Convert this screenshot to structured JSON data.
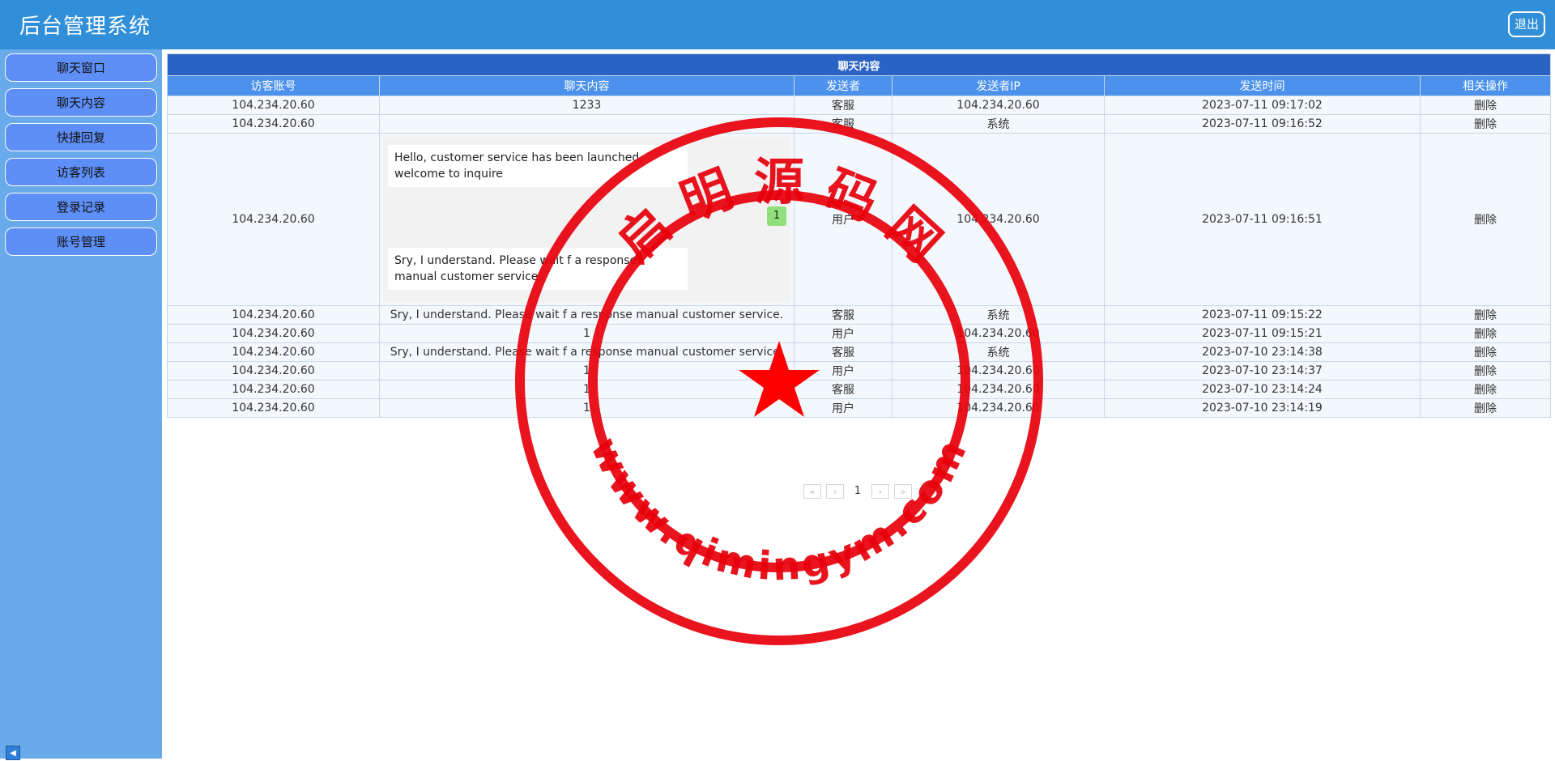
{
  "app": {
    "title": "后台管理系统",
    "logout_label": "退出"
  },
  "sidebar": {
    "items": [
      {
        "label": "聊天窗口"
      },
      {
        "label": "聊天内容"
      },
      {
        "label": "快捷回复"
      },
      {
        "label": "访客列表"
      },
      {
        "label": "登录记录"
      },
      {
        "label": "账号管理"
      }
    ],
    "collapse_icon": "◀"
  },
  "table": {
    "caption": "聊天内容",
    "headers": [
      "访客账号",
      "聊天内容",
      "发送者",
      "发送者IP",
      "发送时间",
      "相关操作"
    ],
    "rows": [
      {
        "account": "104.234.20.60",
        "content": "1233",
        "sender": "客服",
        "ip": "104.234.20.60",
        "time": "2023-07-11 09:17:02",
        "action": "删除"
      },
      {
        "account": "104.234.20.60",
        "content": "",
        "sender": "客服",
        "ip": "系统",
        "time": "2023-07-11 09:16:52",
        "action": "删除"
      },
      {
        "account": "104.234.20.60",
        "content": "",
        "sender": "用户",
        "ip": "104.234.20.60",
        "time": "2023-07-11 09:16:51",
        "action": "删除"
      },
      {
        "account": "104.234.20.60",
        "content": "Sry, I understand. Please wait f a response manual customer service.",
        "sender": "客服",
        "ip": "系统",
        "time": "2023-07-11 09:15:22",
        "action": "删除"
      },
      {
        "account": "104.234.20.60",
        "content": "1",
        "sender": "用户",
        "ip": "104.234.20.60",
        "time": "2023-07-11 09:15:21",
        "action": "删除"
      },
      {
        "account": "104.234.20.60",
        "content": "Sry, I understand. Please wait f a response manual customer service.",
        "sender": "客服",
        "ip": "系统",
        "time": "2023-07-10 23:14:38",
        "action": "删除"
      },
      {
        "account": "104.234.20.60",
        "content": "1",
        "sender": "用户",
        "ip": "104.234.20.60",
        "time": "2023-07-10 23:14:37",
        "action": "删除"
      },
      {
        "account": "104.234.20.60",
        "content": "1",
        "sender": "客服",
        "ip": "104.234.20.60",
        "time": "2023-07-10 23:14:24",
        "action": "删除"
      },
      {
        "account": "104.234.20.60",
        "content": "1",
        "sender": "用户",
        "ip": "104.234.20.60",
        "time": "2023-07-10 23:14:19",
        "action": "删除"
      }
    ],
    "rich_message": {
      "bubble1": "Hello, customer service has been launched, welcome to inquire",
      "bubble2": "Sry, I understand. Please wait f a response manual customer service.",
      "badge": "1"
    }
  },
  "pager": {
    "first": "«",
    "prev": "‹",
    "current": "1",
    "next": "›",
    "last": "»"
  },
  "stamp": {
    "top_text": "启 明 源 码 网",
    "bottom_text": "www.qimingym.com"
  }
}
